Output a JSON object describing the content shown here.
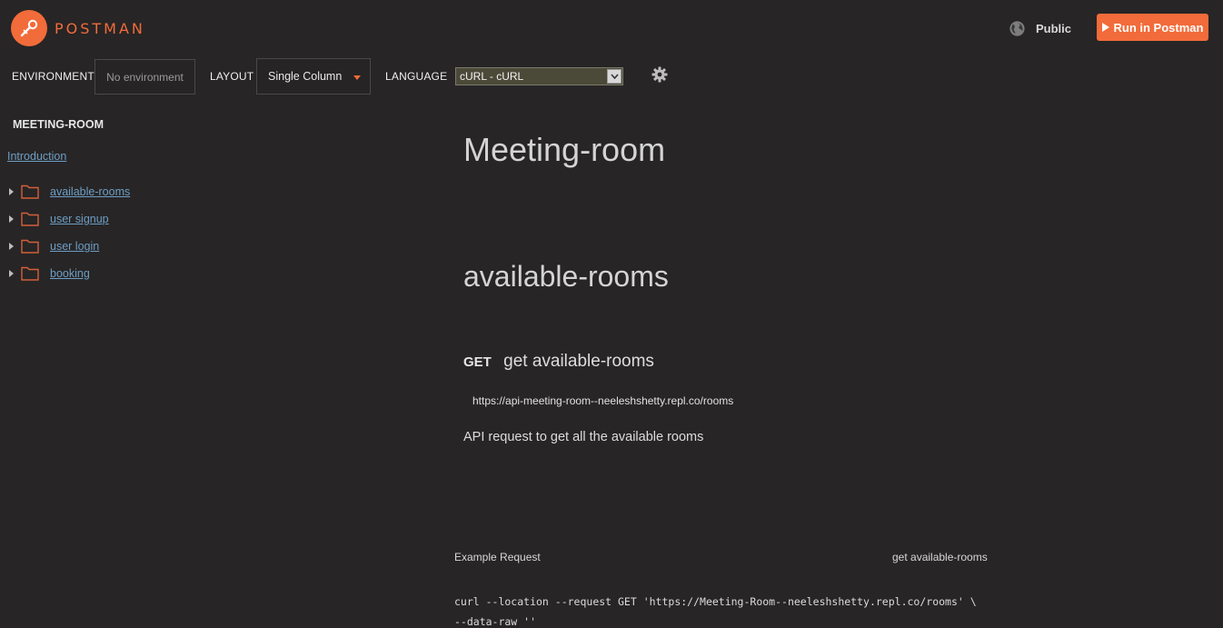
{
  "brand": {
    "name": "POSTMAN",
    "accent_color": "#f26b3a",
    "logo_icon": "postman-rocket-icon"
  },
  "header": {
    "visibility_label": "Public",
    "visibility_icon": "globe-icon",
    "run_button_label": "Run in Postman",
    "run_button_icon": "play-icon"
  },
  "controls": {
    "environment_label": "ENVIRONMENT",
    "environment_value": "No environment",
    "layout_label": "LAYOUT",
    "layout_value": "Single Column",
    "language_label": "LANGUAGE",
    "language_value": "cURL - cURL",
    "settings_icon": "gear-icon"
  },
  "sidebar": {
    "collection_title": "MEETING-ROOM",
    "intro_link": "Introduction",
    "folders": [
      {
        "label": "available-rooms"
      },
      {
        "label": "user signup"
      },
      {
        "label": "user login"
      },
      {
        "label": "booking"
      }
    ]
  },
  "main": {
    "page_title": "Meeting-room",
    "section_title": "available-rooms",
    "request": {
      "method": "GET",
      "name": "get available-rooms",
      "url": "https://api-meeting-room--neeleshshetty.repl.co/rooms",
      "description": "API request to get all the available rooms"
    },
    "example": {
      "label": "Example Request",
      "name": "get available-rooms",
      "code_line_1": "curl --location --request GET 'https://Meeting-Room--neeleshshetty.repl.co/rooms' \\",
      "code_line_2": "--data-raw ''"
    }
  }
}
